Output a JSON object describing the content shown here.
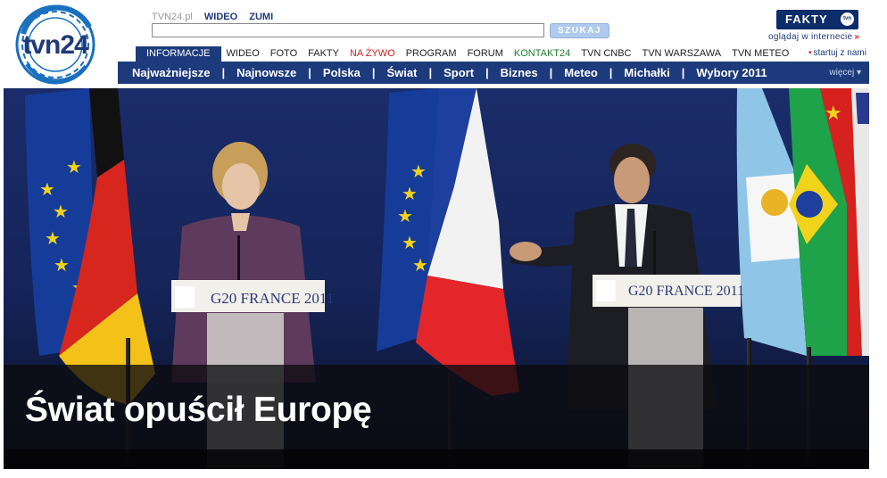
{
  "brand": {
    "logo_text": "tvn24"
  },
  "top_links": {
    "site": "TVN24.pl",
    "wideo": "WIDEO",
    "zumi": "ZUMI"
  },
  "search": {
    "value": "",
    "button_label": "SZUKAJ"
  },
  "fakty": {
    "logo_text": "FAKTY",
    "logo_badge": "tvn",
    "subtitle": "oglądaj w internecie",
    "arrow": "»"
  },
  "startuj": {
    "arrow": "•",
    "label": "startuj z nami"
  },
  "services": [
    {
      "label": "INFORMACJE",
      "state": "active"
    },
    {
      "label": "WIDEO",
      "state": ""
    },
    {
      "label": "FOTO",
      "state": ""
    },
    {
      "label": "FAKTY",
      "state": ""
    },
    {
      "label": "NA ŻYWO",
      "state": "live"
    },
    {
      "label": "PROGRAM",
      "state": ""
    },
    {
      "label": "FORUM",
      "state": ""
    },
    {
      "label": "KONTAKT24",
      "state": "k24"
    },
    {
      "label": "TVN CNBC",
      "state": ""
    },
    {
      "label": "TVN WARSZAWA",
      "state": ""
    },
    {
      "label": "TVN METEO",
      "state": ""
    }
  ],
  "main_nav": {
    "separator": "|",
    "items": [
      "Najważniejsze",
      "Najnowsze",
      "Polska",
      "Świat",
      "Sport",
      "Biznes",
      "Meteo",
      "Michałki",
      "Wybory 2011"
    ],
    "more_label": "więcej ▾"
  },
  "hero": {
    "headline": "Świat opuścił Europę",
    "podium_left": "G20 FRANCE 2011",
    "podium_right": "G20 FRANCE 2011"
  },
  "colors": {
    "nav_blue": "#1d3b7c",
    "accent_red": "#cc1f1f",
    "kontakt_green": "#1a7d2e",
    "search_button": "#aecbee"
  }
}
